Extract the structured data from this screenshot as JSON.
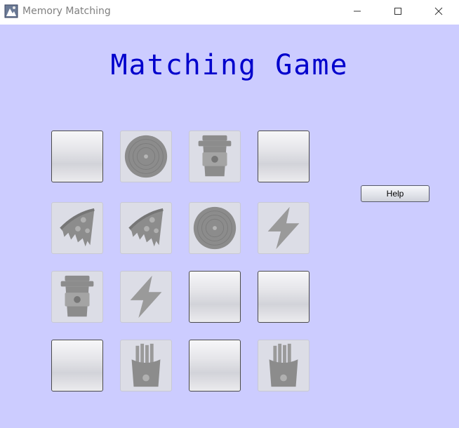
{
  "window": {
    "title": "Memory Matching",
    "controls": [
      "minimize",
      "maximize",
      "close"
    ]
  },
  "colors": {
    "background": "#ccccff",
    "title_color": "#0000cc",
    "icon_gray": "#8c8c8c"
  },
  "game": {
    "title": "Matching Game",
    "help_label": "Help",
    "board": [
      [
        {
          "state": "face-down"
        },
        {
          "state": "face-up",
          "icon": "vinyl-record-icon"
        },
        {
          "state": "face-up",
          "icon": "coffee-cup-icon"
        },
        {
          "state": "face-down"
        }
      ],
      [
        {
          "state": "face-up",
          "icon": "pizza-slice-icon"
        },
        {
          "state": "face-up",
          "icon": "pizza-slice-icon"
        },
        {
          "state": "face-up",
          "icon": "vinyl-record-icon"
        },
        {
          "state": "face-up",
          "icon": "lightning-bolt-icon"
        }
      ],
      [
        {
          "state": "face-up",
          "icon": "coffee-cup-icon"
        },
        {
          "state": "face-up",
          "icon": "lightning-bolt-icon"
        },
        {
          "state": "face-down"
        },
        {
          "state": "face-down"
        }
      ],
      [
        {
          "state": "face-down"
        },
        {
          "state": "face-up",
          "icon": "french-fries-icon"
        },
        {
          "state": "face-down"
        },
        {
          "state": "face-up",
          "icon": "french-fries-icon"
        }
      ]
    ]
  }
}
